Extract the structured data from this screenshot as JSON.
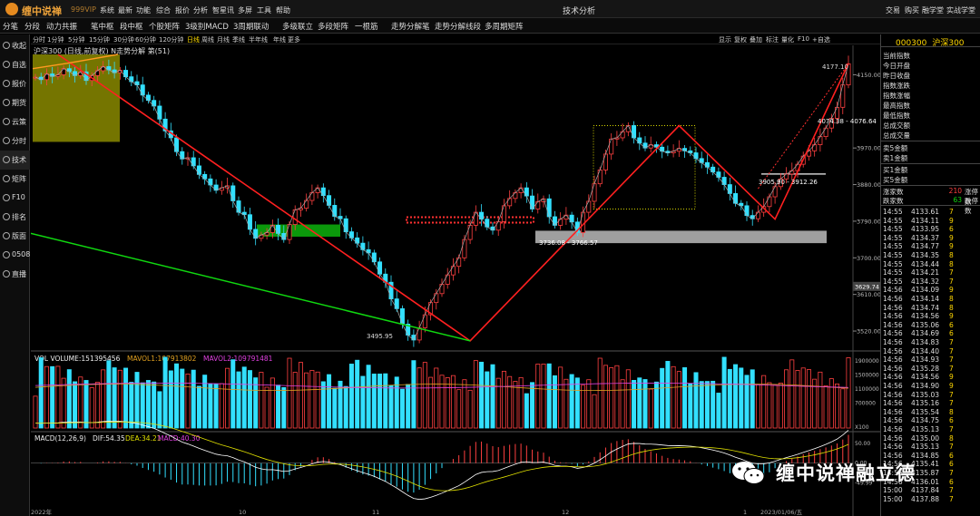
{
  "app": {
    "title": "缠中说禅",
    "version": "999VIP",
    "center_title": "技术分析",
    "menu": [
      "系统",
      "最新",
      "功能",
      "综合",
      "报价",
      "分析",
      "智星讯",
      "多屏",
      "工具",
      "帮助"
    ],
    "right_links": [
      "交易",
      "购买",
      "融学堂",
      "实战学堂"
    ]
  },
  "toolbar": [
    "分笔",
    "分段",
    "动力共振",
    "笔中枢",
    "段中枢",
    "个股矩阵",
    "3级别MACD",
    "3周期联动",
    "多级联立",
    "多段矩阵",
    "一根筋",
    "走势分解笔",
    "走势分解线段",
    "多周期矩阵"
  ],
  "sidebar": [
    "收起",
    "自选",
    "报价",
    "期货",
    "云策",
    "分时",
    "技术",
    "矩阵",
    "F10",
    "排名",
    "版面",
    "0508",
    "直播"
  ],
  "periods": [
    "分时",
    "1分钟",
    "5分钟",
    "15分钟",
    "30分钟",
    "60分钟",
    "120分钟",
    "日线",
    "周线",
    "月线",
    "季线",
    "半年线",
    "年线",
    "更多"
  ],
  "selected_period": "日线",
  "right_tools": [
    "显示",
    "复权",
    "叠加",
    "标注",
    "量化",
    "F10",
    "+自选"
  ],
  "chart_title": "沪深300 (日线,前复权) N走势分解 第(51)",
  "colors": {
    "up": "#ff4040",
    "down": "#33e0ff",
    "bi_line": "#ff2020",
    "segment_line": "#10d810",
    "ma_line": "#ff9a20",
    "accent": "#ffd700"
  },
  "chart_data": [
    {
      "type": "candlestick",
      "title": "沪深300 (日线,前复权)",
      "ylim": [
        3480,
        4200
      ],
      "price_ticks": [
        "4150.00",
        "3970.00",
        "3880.00",
        "3790.00",
        "3700.00",
        "3610.00",
        "3520.00"
      ],
      "current_price": "3629.74",
      "x_labels": [
        "2022年",
        "10",
        "11",
        "12",
        "1",
        "2023/01/06/五"
      ],
      "annotations": [
        "4177.10",
        "4074.38 - 4076.64",
        "3905.90 - 3912.26",
        "3736.08 - 3766.57",
        "3495.95"
      ],
      "bi_points": [
        {
          "date": "2022-08-18",
          "price": 4200
        },
        {
          "date": "2022-10-31",
          "price": 3495.95
        },
        {
          "date": "2022-12-07",
          "price": 4025
        },
        {
          "date": "2022-12-23",
          "price": 3795
        },
        {
          "date": "2023-01-06",
          "price": 4177.1
        }
      ],
      "close": [
        4144,
        4138,
        4152,
        4146,
        4150,
        4165,
        4158,
        4148,
        4157,
        4136,
        4148,
        4160,
        4170,
        4162,
        4155,
        4161,
        4145,
        4133,
        4125,
        4100,
        4087,
        4073,
        4041,
        4012,
        3995,
        3961,
        3943,
        3946,
        3926,
        3905,
        3894,
        3879,
        3866,
        3872,
        3877,
        3840,
        3812,
        3806,
        3770,
        3748,
        3756,
        3762,
        3780,
        3760,
        3745,
        3782,
        3818,
        3822,
        3841,
        3860,
        3872,
        3853,
        3829,
        3802,
        3796,
        3764,
        3749,
        3736,
        3720,
        3712,
        3690,
        3660,
        3640,
        3599,
        3575,
        3537,
        3510,
        3498,
        3528,
        3560,
        3590,
        3612,
        3635,
        3658,
        3679,
        3700,
        3745,
        3780,
        3812,
        3795,
        3776,
        3768,
        3789,
        3828,
        3846,
        3860,
        3872,
        3852,
        3820,
        3838,
        3845,
        3801,
        3780,
        3795,
        3805,
        3788,
        3762,
        3812,
        3839,
        3882,
        3916,
        3955,
        3992,
        3995,
        4010,
        4025,
        3995,
        3982,
        3970,
        3978,
        3972,
        3962,
        3958,
        3962,
        3969,
        3963,
        3958,
        3944,
        3934,
        3923,
        3911,
        3898,
        3880,
        3858,
        3834,
        3828,
        3804,
        3796,
        3812,
        3826,
        3850,
        3875,
        3894,
        3906,
        3914,
        3930,
        3950,
        3963,
        3978,
        3998,
        4019,
        4043,
        4070,
        4125,
        4177
      ]
    },
    {
      "type": "bar",
      "title": "VOL",
      "series": [
        {
          "name": "VOLUME",
          "last": "151395456"
        },
        {
          "name": "MAVOL1",
          "last": "107913802"
        },
        {
          "name": "MAVOL2",
          "last": "109791481"
        }
      ],
      "ylim": [
        0,
        2100000
      ],
      "ticks": [
        "1900000",
        "1500000",
        "1100000",
        "700000",
        "X100"
      ]
    },
    {
      "type": "line",
      "title": "MACD(12,26,9)",
      "series": [
        {
          "name": "DIF",
          "last": "54.35"
        },
        {
          "name": "DEA",
          "last": "34.21"
        },
        {
          "name": "MACD",
          "last": "40.30"
        }
      ],
      "ylim": [
        -110,
        70
      ],
      "ticks": [
        "50.00",
        "0.00",
        "-49.99"
      ]
    }
  ],
  "right_panel": {
    "code": "000300",
    "name": "沪深300",
    "info_labels": [
      "当前指数",
      "今日开盘",
      "昨日收盘",
      "指数涨跌",
      "指数涨幅",
      "最高指数",
      "最低指数",
      "总成交额",
      "总成交量"
    ],
    "bids": [
      "卖5金额",
      "卖1金额",
      "买1金额",
      "买5金额"
    ],
    "stats": [
      {
        "label": "涨家数",
        "value": "210",
        "ext": "涨停数"
      },
      {
        "label": "跌家数",
        "value": "63",
        "ext": "跌停数"
      }
    ],
    "ticks": [
      {
        "t": "14:55",
        "p": "4133.61",
        "v": "7"
      },
      {
        "t": "14:55",
        "p": "4134.11",
        "v": "9"
      },
      {
        "t": "14:55",
        "p": "4133.95",
        "v": "6"
      },
      {
        "t": "14:55",
        "p": "4134.37",
        "v": "9"
      },
      {
        "t": "14:55",
        "p": "4134.77",
        "v": "9"
      },
      {
        "t": "14:55",
        "p": "4134.35",
        "v": "8"
      },
      {
        "t": "14:55",
        "p": "4134.44",
        "v": "8"
      },
      {
        "t": "14:55",
        "p": "4134.21",
        "v": "7"
      },
      {
        "t": "14:55",
        "p": "4134.32",
        "v": "7"
      },
      {
        "t": "14:56",
        "p": "4134.09",
        "v": "9"
      },
      {
        "t": "14:56",
        "p": "4134.14",
        "v": "8"
      },
      {
        "t": "14:56",
        "p": "4134.74",
        "v": "8"
      },
      {
        "t": "14:56",
        "p": "4134.56",
        "v": "9"
      },
      {
        "t": "14:56",
        "p": "4135.06",
        "v": "6"
      },
      {
        "t": "14:56",
        "p": "4134.69",
        "v": "6"
      },
      {
        "t": "14:56",
        "p": "4134.83",
        "v": "7"
      },
      {
        "t": "14:56",
        "p": "4134.40",
        "v": "7"
      },
      {
        "t": "14:56",
        "p": "4134.93",
        "v": "7"
      },
      {
        "t": "14:56",
        "p": "4135.28",
        "v": "7"
      },
      {
        "t": "14:56",
        "p": "4134.56",
        "v": "9"
      },
      {
        "t": "14:56",
        "p": "4134.90",
        "v": "9"
      },
      {
        "t": "14:56",
        "p": "4135.03",
        "v": "7"
      },
      {
        "t": "14:56",
        "p": "4135.16",
        "v": "7"
      },
      {
        "t": "14:56",
        "p": "4135.54",
        "v": "8"
      },
      {
        "t": "14:56",
        "p": "4134.75",
        "v": "6"
      },
      {
        "t": "14:56",
        "p": "4135.13",
        "v": "7"
      },
      {
        "t": "14:56",
        "p": "4135.00",
        "v": "8"
      },
      {
        "t": "14:56",
        "p": "4135.13",
        "v": "7"
      },
      {
        "t": "14:56",
        "p": "4134.85",
        "v": "6"
      },
      {
        "t": "14:56",
        "p": "4135.41",
        "v": "6"
      },
      {
        "t": "14:56",
        "p": "4135.87",
        "v": "7"
      },
      {
        "t": "14:56",
        "p": "4136.01",
        "v": "6"
      },
      {
        "t": "15:00",
        "p": "4137.84",
        "v": "7"
      },
      {
        "t": "15:00",
        "p": "4137.88",
        "v": "7"
      }
    ]
  },
  "watermark": {
    "text": "缠中说禅融立德"
  }
}
